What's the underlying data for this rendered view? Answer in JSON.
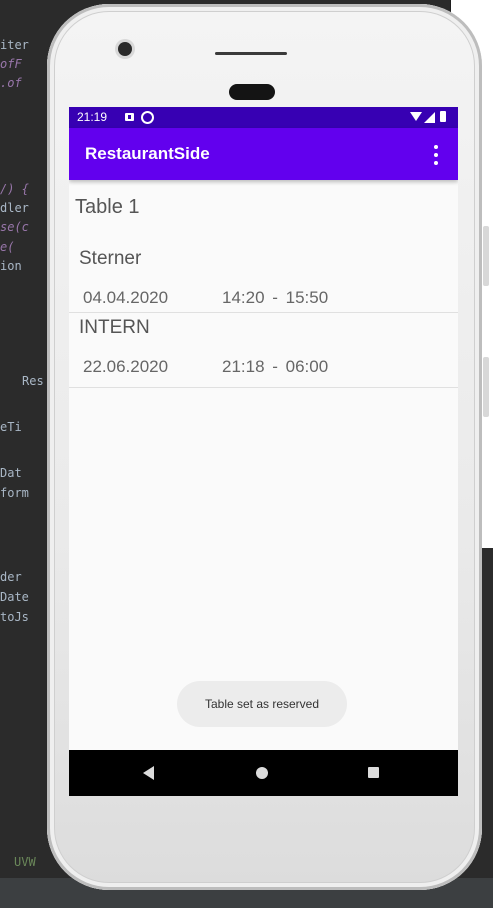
{
  "ide": {
    "lines": [
      "iter",
      "ofF",
      ".of",
      "/) {",
      "dler",
      "se(c",
      "e(",
      "ion",
      "Res",
      "eTi",
      "Dat",
      "form",
      "der",
      "Date",
      "toJs",
      "UVW"
    ]
  },
  "status_bar": {
    "time": "21:19",
    "icons": [
      "notification-icon",
      "sync-icon",
      "wifi-icon",
      "signal-icon",
      "battery-icon"
    ]
  },
  "app_bar": {
    "title": "RestaurantSide",
    "menu_icon": "overflow-menu-icon"
  },
  "table": {
    "title": "Table 1"
  },
  "reservations": [
    {
      "name": "Sterner",
      "date": "04.04.2020",
      "time": "14:20  -  15:50"
    },
    {
      "name": "INTERN",
      "date": "22.06.2020",
      "time": "21:18  -  06:00"
    }
  ],
  "toast": {
    "message": "Table set as reserved"
  },
  "nav_bar": {
    "buttons": [
      "back-icon",
      "home-icon",
      "recents-icon"
    ]
  },
  "colors": {
    "status_bar": "#3700b3",
    "app_bar": "#6200ee",
    "screen_background": "#fafafa"
  }
}
